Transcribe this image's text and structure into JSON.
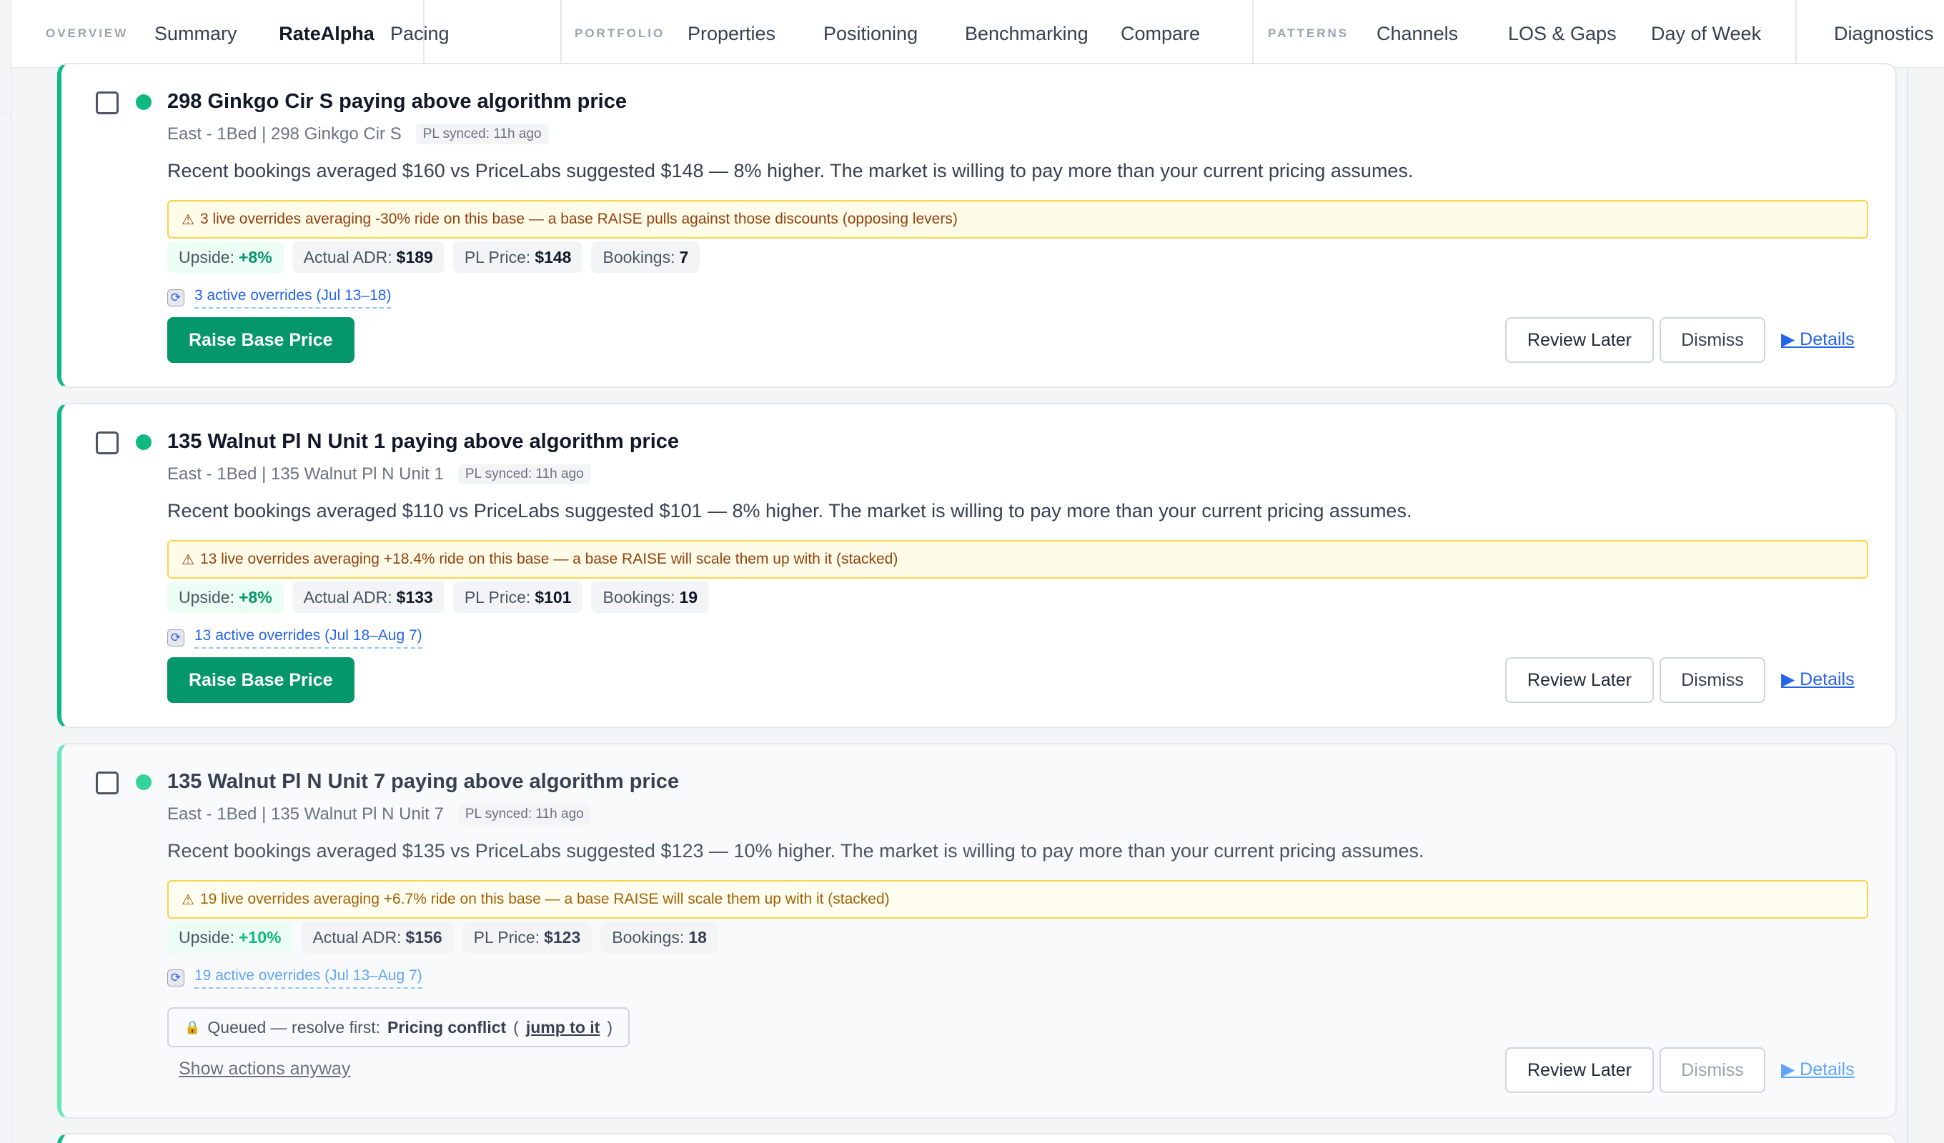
{
  "nav": {
    "sections": [
      {
        "label": "OVERVIEW",
        "tabs": [
          "Summary",
          "RateAlpha"
        ]
      },
      {
        "label": "",
        "tabs": [
          "Pacing"
        ]
      },
      {
        "label": "PORTFOLIO",
        "tabs": [
          "Properties",
          "Positioning",
          "Benchmarking",
          "Compare"
        ]
      },
      {
        "label": "PATTERNS",
        "tabs": [
          "Channels",
          "LOS & Gaps",
          "Day of Week"
        ]
      },
      {
        "label": "",
        "tabs": [
          "Diagnostics"
        ]
      }
    ],
    "active_tab": "RateAlpha"
  },
  "cards": [
    {
      "title": "298 Ginkgo Cir S paying above algorithm price",
      "meta": "East - 1Bed | 298 Ginkgo Cir S",
      "sync": "PL synced: 11h ago",
      "description": "Recent bookings averaged $160 vs PriceLabs suggested $148 — 8% higher. The market is willing to pay more than your current pricing assumes.",
      "warning": "3 live overrides averaging -30% ride on this base — a base RAISE pulls against those discounts (opposing levers)",
      "chips": [
        {
          "label": "Upside:",
          "value": "+8%"
        },
        {
          "label": "Actual ADR:",
          "value": "$189"
        },
        {
          "label": "PL Price:",
          "value": "$148"
        },
        {
          "label": "Bookings:",
          "value": "7"
        }
      ],
      "overrides_link": "3 active overrides (Jul 13–18)",
      "primary_action": "Raise Base Price",
      "review_later": "Review Later",
      "dismiss": "Dismiss",
      "details": "▶ Details"
    },
    {
      "title": "135 Walnut Pl N Unit 1 paying above algorithm price",
      "meta": "East - 1Bed | 135 Walnut Pl N Unit 1",
      "sync": "PL synced: 11h ago",
      "description": "Recent bookings averaged $110 vs PriceLabs suggested $101 — 8% higher. The market is willing to pay more than your current pricing assumes.",
      "warning": "13 live overrides averaging +18.4% ride on this base — a base RAISE will scale them up with it (stacked)",
      "chips": [
        {
          "label": "Upside:",
          "value": "+8%"
        },
        {
          "label": "Actual ADR:",
          "value": "$133"
        },
        {
          "label": "PL Price:",
          "value": "$101"
        },
        {
          "label": "Bookings:",
          "value": "19"
        }
      ],
      "overrides_link": "13 active overrides (Jul 18–Aug 7)",
      "primary_action": "Raise Base Price",
      "review_later": "Review Later",
      "dismiss": "Dismiss",
      "details": "▶ Details"
    },
    {
      "title": "135 Walnut Pl N Unit 7 paying above algorithm price",
      "meta": "East - 1Bed | 135 Walnut Pl N Unit 7",
      "sync": "PL synced: 11h ago",
      "description": "Recent bookings averaged $135 vs PriceLabs suggested $123 — 10% higher. The market is willing to pay more than your current pricing assumes.",
      "warning": "19 live overrides averaging +6.7% ride on this base — a base RAISE will scale them up with it (stacked)",
      "chips": [
        {
          "label": "Upside:",
          "value": "+10%"
        },
        {
          "label": "Actual ADR:",
          "value": "$156"
        },
        {
          "label": "PL Price:",
          "value": "$123"
        },
        {
          "label": "Bookings:",
          "value": "18"
        }
      ],
      "overrides_link": "19 active overrides (Jul 13–Aug 7)",
      "queued": {
        "prefix": "Queued — resolve first:",
        "conflict": "Pricing conflict",
        "open_paren": "(",
        "jump": "jump to it",
        "close_paren": ")"
      },
      "show_actions": "Show actions anyway",
      "review_later": "Review Later",
      "dismiss": "Dismiss",
      "details": "▶ Details"
    }
  ],
  "icons": {
    "warning": "warning-triangle-icon",
    "override": "refresh-icon",
    "lock": "lock-icon"
  },
  "colors": {
    "accent_green": "#059669",
    "status_dot": "#10b981",
    "link_blue": "#2563eb",
    "warning_border": "#fcd34d"
  }
}
